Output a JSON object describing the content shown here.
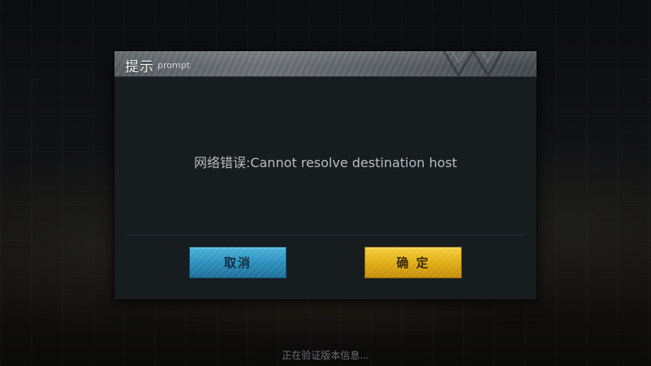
{
  "dialog": {
    "title": "提示",
    "subtitle": "prompt",
    "message": "网络错误:Cannot resolve destination host",
    "cancel_label": "取消",
    "confirm_label": "确 定"
  },
  "status_text": "正在验证版本信息...",
  "colors": {
    "dialog_background": "#171c1f",
    "header_background": "#6e7377",
    "cancel_button": "#2b8fbd",
    "confirm_button": "#e0ad14",
    "message_text": "#b7bcbf"
  }
}
